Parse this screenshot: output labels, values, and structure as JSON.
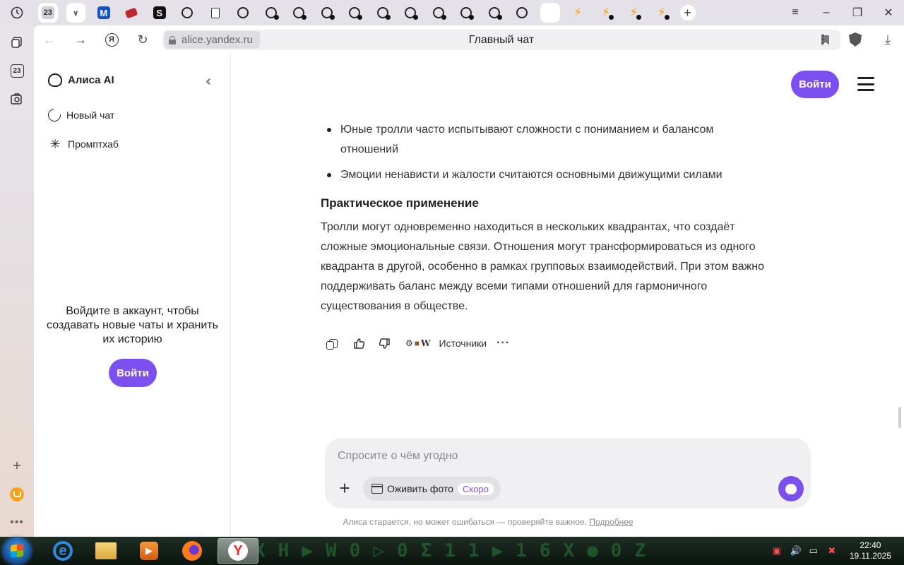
{
  "browser": {
    "tab_badge_number": "23",
    "url": "alice.yandex.ru",
    "page_title": "Главный чат",
    "rail_badge_number": "23",
    "tab_icons": [
      "badge-23",
      "chevron-down",
      "m-logo",
      "red-ticket",
      "s-logo",
      "chatgpt",
      "chatgpt",
      "document",
      "chatgpt",
      "chatgpt-dot",
      "chatgpt-dot",
      "chatgpt-dot",
      "chatgpt-dot",
      "chatgpt-dot",
      "chatgpt-dot",
      "chatgpt-dot",
      "chatgpt-dot",
      "chatgpt-dot",
      "chatgpt",
      "alice",
      "bolt",
      "bolt-dot",
      "bolt-dot",
      "bolt-dot"
    ]
  },
  "sidebar": {
    "brand": "Алиса AI",
    "new_chat": "Новый чат",
    "promptхаб": "Промптхаб",
    "login_prompt": "Войдите в аккаунт, чтобы создавать новые чаты и хранить их историю",
    "login_button": "Войти"
  },
  "header": {
    "login_button": "Войти"
  },
  "answer": {
    "bullets": [
      "Юные тролли часто испытывают сложности с пониманием и балансом отношений",
      "Эмоции ненависти и жалости считаются основными движущими силами"
    ],
    "heading": "Практическое применение",
    "paragraph": "Тролли могут одновременно находиться в нескольких квадрантах, что создаёт сложные эмоциональные связи. Отношения могут трансформироваться из одного квадранта в другой, особенно в рамках групповых взаимодействий. При этом важно поддерживать баланс между всеми типами отношений для гармоничного существования в обществе.",
    "sources_label": "Источники",
    "sources_wiki_glyph": "W"
  },
  "composer": {
    "placeholder": "Спросите о чём угодно",
    "revive_photo": "Оживить фото",
    "soon_badge": "Скоро"
  },
  "footer": {
    "disclaimer": "Алиса старается, но может ошибаться — проверяйте важное.",
    "more_link": "Подробнее"
  },
  "taskbar": {
    "wallpaper_glyphs": "XH▶W0▷0Σ11▶16X●0Z",
    "time": "22:40",
    "date": "19.11.2025"
  },
  "colors": {
    "accent": "#7c4fef",
    "tabstrip": "#e4e2e8",
    "taskbar": "#0b140e"
  }
}
